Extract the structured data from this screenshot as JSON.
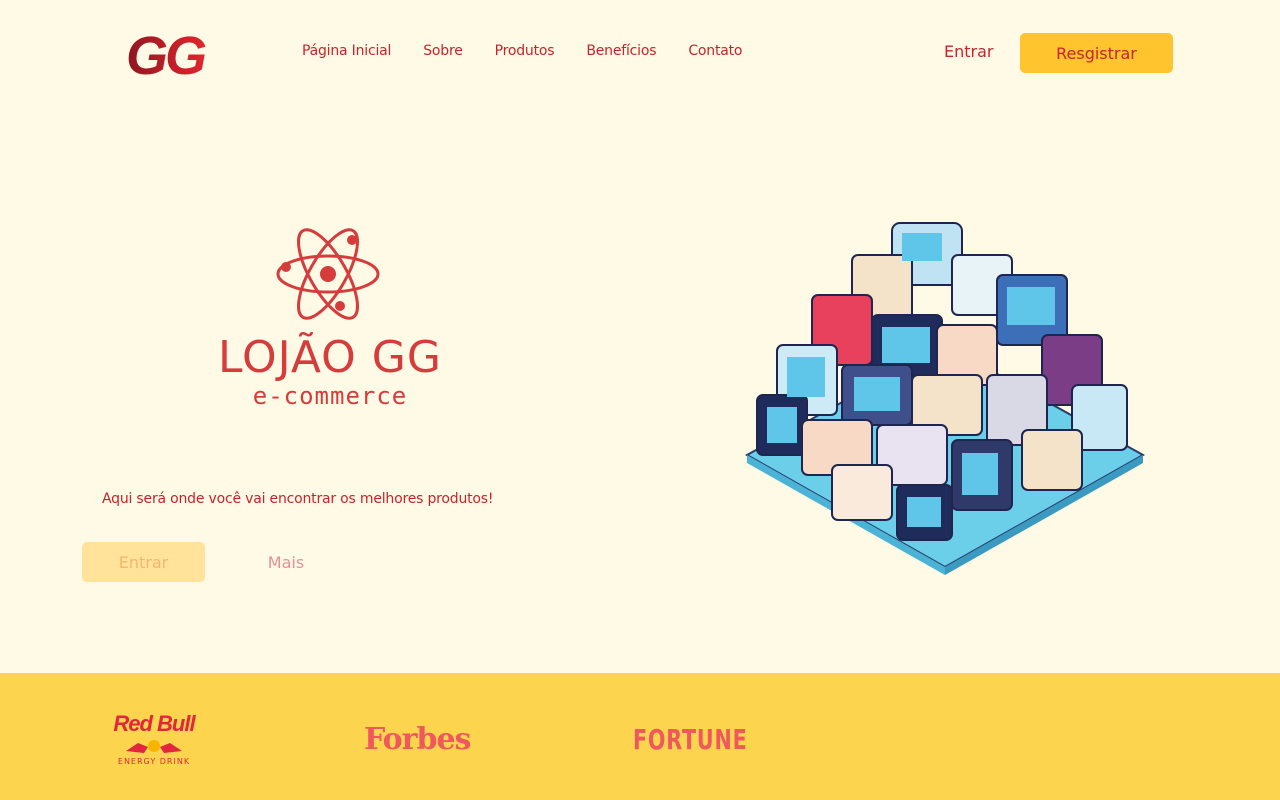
{
  "header": {
    "logo_text": "GG",
    "nav": [
      "Página Inicial",
      "Sobre",
      "Produtos",
      "Benefícios",
      "Contato"
    ],
    "login_label": "Entrar",
    "register_label": "Resgistrar"
  },
  "hero": {
    "brand_title": "LOJÃO GG",
    "brand_subtitle": "e-commerce",
    "tagline": "Aqui será onde você vai encontrar os melhores produtos!",
    "enter_label": "Entrar",
    "more_label": "Mais",
    "logo_icon": "atom-icon",
    "illustration": "isometric-electronics-illustration"
  },
  "partners": {
    "items": [
      "Red Bull",
      "Forbes",
      "FORTUNE"
    ],
    "redbull_sub": "ENERGY DRINK"
  },
  "colors": {
    "background": "#FEFAE6",
    "accent": "#FFC42E",
    "primary_text": "#C8232C",
    "band": "#FDD44E"
  }
}
